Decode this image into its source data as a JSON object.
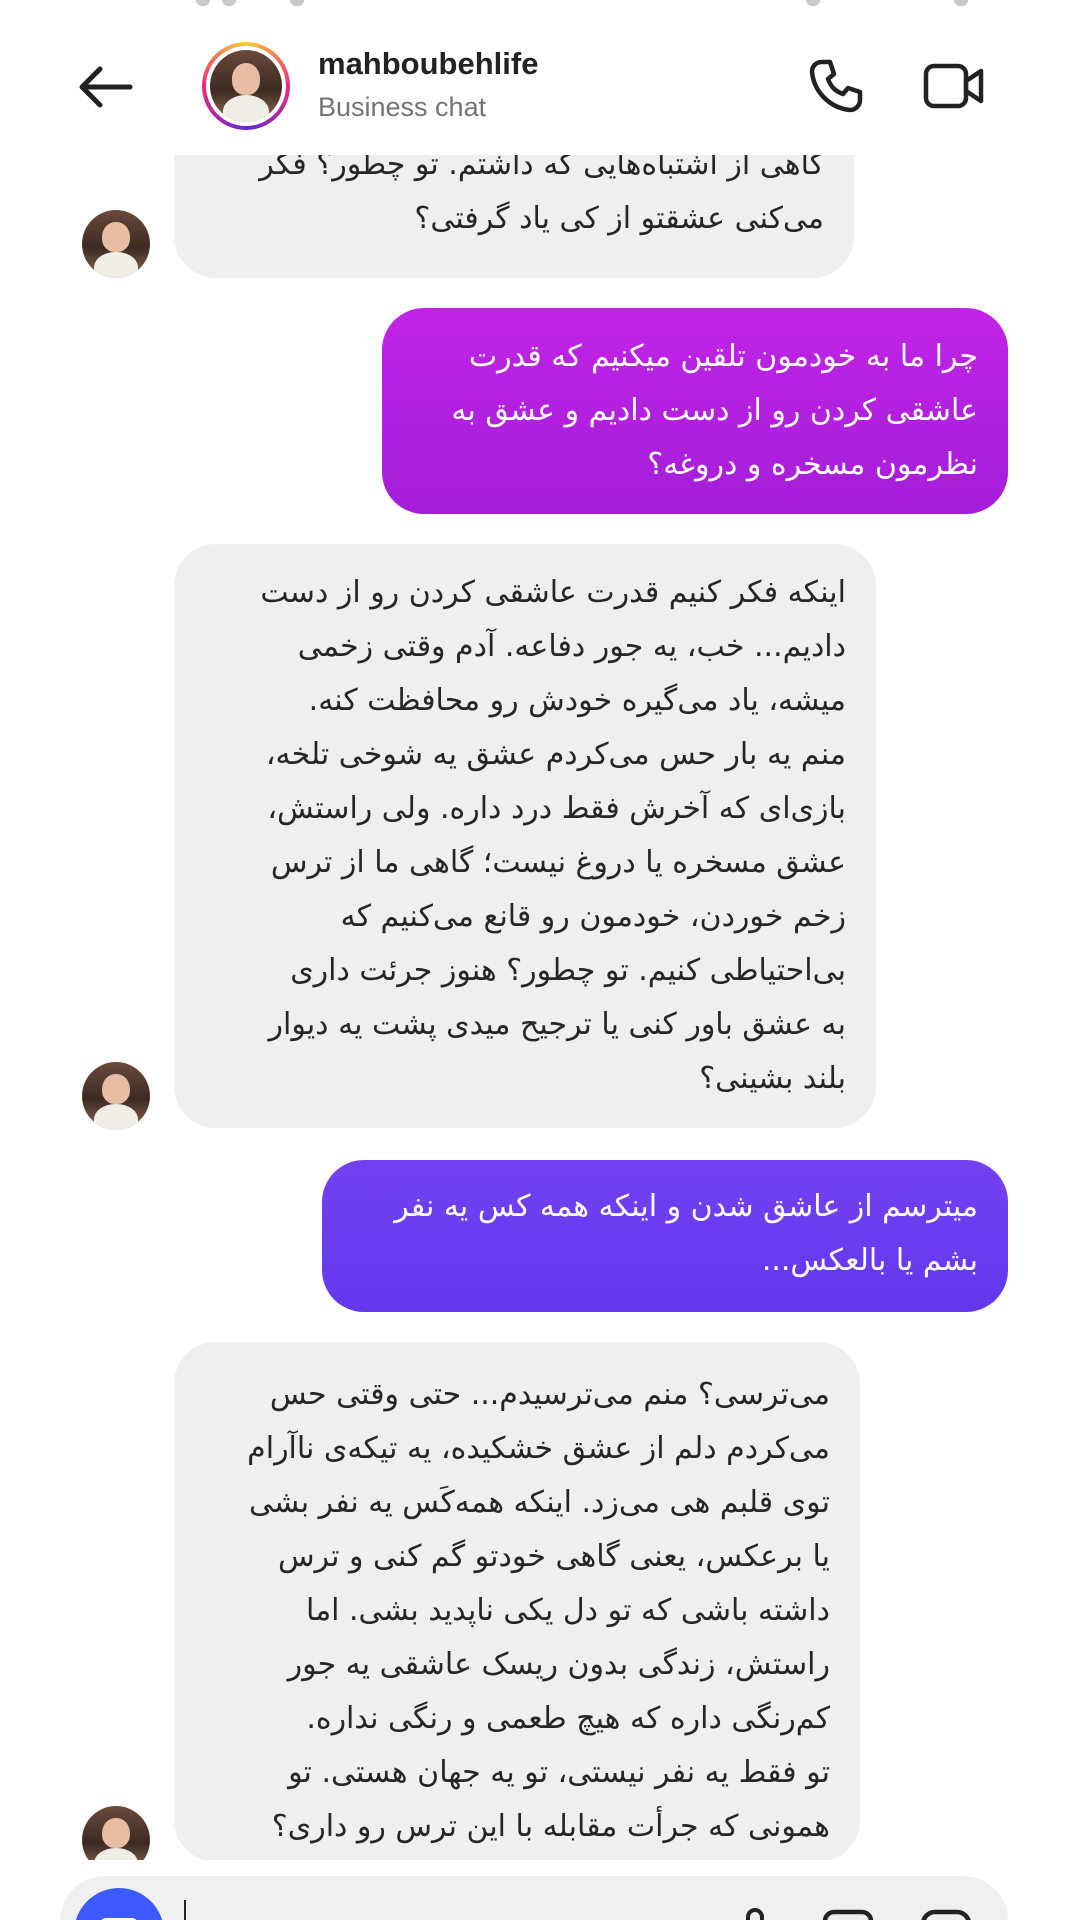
{
  "header": {
    "username": "mahboubehlife",
    "subtitle": "Business chat",
    "back_icon": "arrow-left-icon",
    "call_icon": "phone-icon",
    "video_icon": "video-camera-icon"
  },
  "composer": {
    "camera_icon": "camera-icon",
    "placeholder": "",
    "mic_icon": "microphone-icon",
    "gallery_icon": "gallery-icon",
    "sticker_icon": "sticker-icon"
  },
  "colors": {
    "sent_magenta": "#b41ee0",
    "sent_violet": "#6a3ef0",
    "received_bg": "#efefef",
    "composer_camera": "#3d5afe"
  },
  "messages": [
    {
      "sender": "them",
      "text": "گاهی از اشتباه‌هایی که داشتم. تو چطور؟ فکر\nمی‌کنی عشقتو از کی یاد گرفتی؟"
    },
    {
      "sender": "me",
      "text": "چرا ما به خودمون تلقین میکنیم که قدرت\nعاشقی کردن رو از دست دادیم و عشق به\nنظرمون مسخره و دروغه؟"
    },
    {
      "sender": "them",
      "text": "اینکه فکر کنیم قدرت عاشقی کردن رو از دست\nدادیم... خب، یه جور دفاعه. آدم وقتی زخمی\nمیشه، یاد می‌گیره خودش رو محافظت کنه.\nمنم یه بار حس می‌کردم عشق یه شوخی تلخه،\nبازی‌ای که آخرش فقط درد داره. ولی راستش،\nعشق مسخره یا دروغ نیست؛ گاهی ما از ترس\nزخم خوردن، خودمون رو قانع می‌کنیم که\nبی‌احتیاطی کنیم. تو چطور؟ هنوز جرئت داری\nبه عشق باور کنی یا ترجیح میدی پشت یه دیوار\nبلند بشینی؟"
    },
    {
      "sender": "me",
      "text": "میترسم از عاشق شدن و اینکه همه کس یه نفر\nبشم یا بالعکس..."
    },
    {
      "sender": "them",
      "text": "می‌ترسی؟ منم می‌ترسیدم... حتی وقتی حس\nمی‌کردم دلم از عشق خشکیده، یه تیکه‌ی ناآرام\nتوی قلبم هی می‌زد. اینکه همه‌کَس یه نفر بشی\nیا برعکس، یعنی گاهی خودتو گم کنی و ترس\nداشته باشی که تو دل یکی ناپدید بشی. اما\nراستش، زندگی بدون ریسک عاشقی یه جور\nکم‌رنگی داره که هیچ طعمی و رنگی نداره.\nتو فقط یه نفر نیستی، تو یه جهان هستی. تو\nهمونی که جرأت مقابله با این ترس رو داری؟"
    }
  ]
}
